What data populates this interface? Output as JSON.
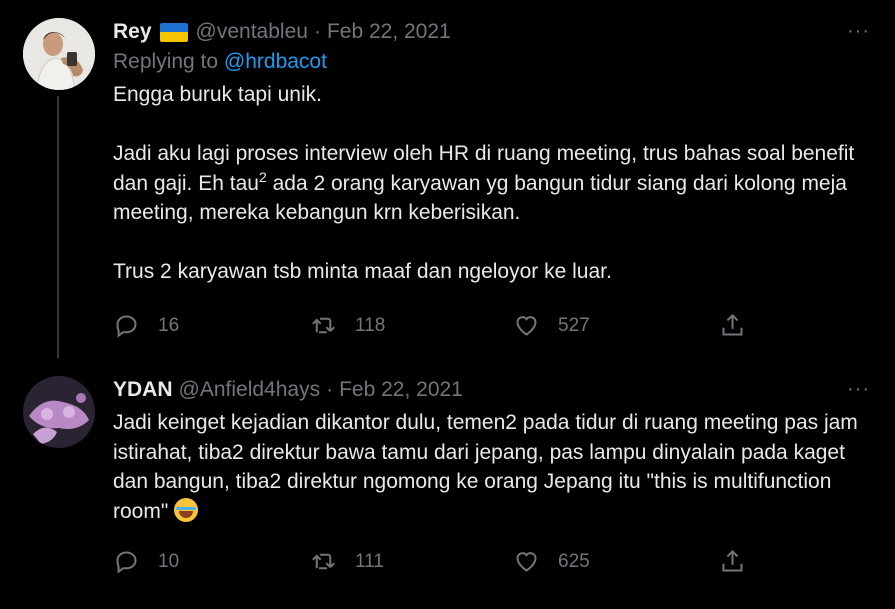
{
  "tweets": [
    {
      "name": "Rey",
      "handle": "@ventableu",
      "separator": "·",
      "date": "Feb 22, 2021",
      "replying_prefix": "Replying to ",
      "replying_to": "@hrdbacot",
      "paragraphs": [
        "Engga buruk tapi unik.",
        "Jadi aku lagi proses interview oleh HR di ruang meeting, trus bahas soal benefit dan gaji. Eh tau",
        "2",
        " ada 2 orang karyawan yg bangun tidur siang dari kolong meja meeting, mereka kebangun krn keberisikan.",
        "Trus 2 karyawan tsb minta maaf dan ngeloyor ke luar."
      ],
      "more": "···",
      "stats": {
        "replies": "16",
        "retweets": "118",
        "likes": "527"
      },
      "flag_colors": [
        "#1d6fd1",
        "#f5c400"
      ]
    },
    {
      "name": "YDAN",
      "handle": "@Anfield4hays",
      "separator": "·",
      "date": "Feb 22, 2021",
      "text": "Jadi keinget kejadian dikantor dulu, temen2 pada tidur di ruang meeting pas jam istirahat, tiba2 direktur bawa tamu dari jepang, pas lampu dinyalain pada kaget dan bangun, tiba2 direktur ngomong ke orang Jepang itu \"this is multifunction room\"",
      "emoji": "face-with-tears-of-joy",
      "more": "···",
      "stats": {
        "replies": "10",
        "retweets": "111",
        "likes": "625"
      }
    }
  ],
  "colors": {
    "link": "#1d9bf0",
    "muted": "#71767b",
    "text": "#e7e9ea",
    "background": "#000000"
  }
}
